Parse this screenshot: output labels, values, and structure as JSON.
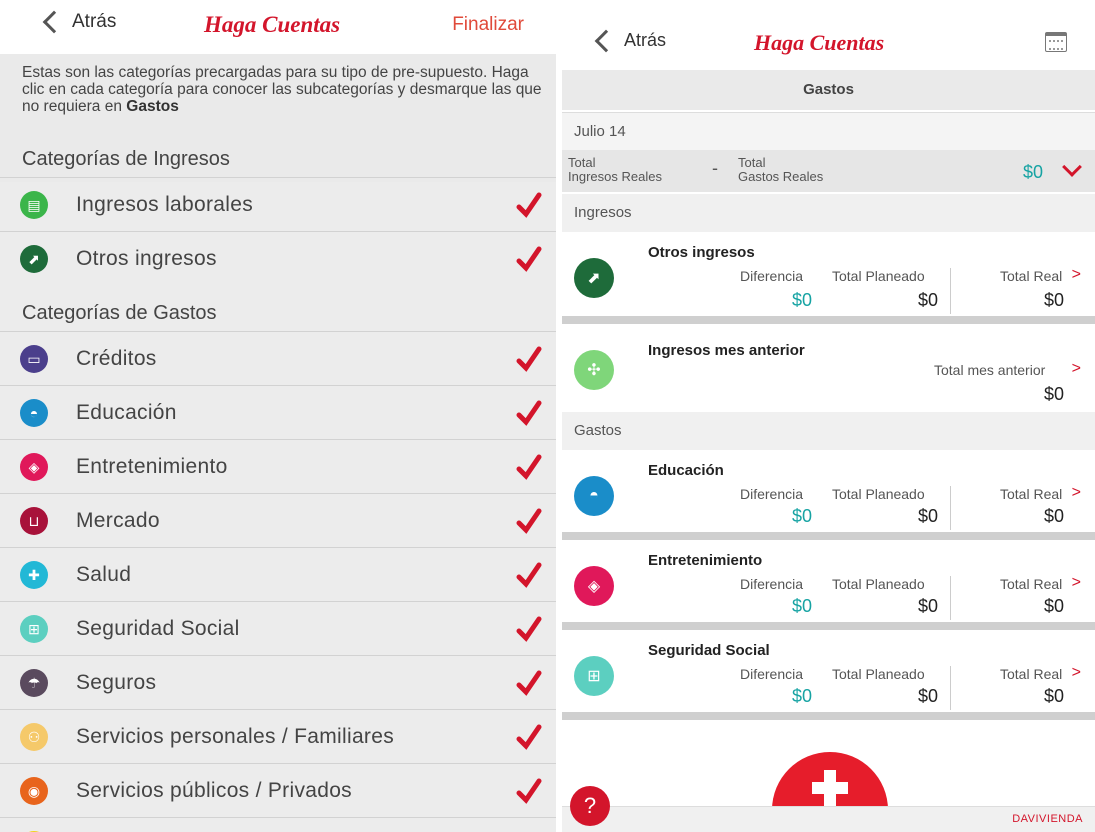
{
  "left": {
    "back_label": "Atrás",
    "brand": "Haga Cuentas",
    "finish_label": "Finalizar",
    "intro_text": "Estas son las categorías precargadas para su tipo de pre-supuesto. Haga clic en cada categoría para conocer las subcategorías y desmarque las que no requiera en",
    "intro_bold": "Gastos",
    "income_section": "Categorías de Ingresos",
    "income_items": [
      {
        "label": "Ingresos laborales",
        "icon": "payroll-icon",
        "color": "#3bb54a"
      },
      {
        "label": "Otros ingresos",
        "icon": "growth-chart-icon",
        "color": "#1e6b3a"
      }
    ],
    "expense_section": "Categorías de Gastos",
    "expense_items": [
      {
        "label": "Créditos",
        "icon": "wallet-icon",
        "color": "#4b3f8c"
      },
      {
        "label": "Educación",
        "icon": "graduation-cap-icon",
        "color": "#1a8dc9"
      },
      {
        "label": "Entretenimiento",
        "icon": "dice-icon",
        "color": "#e0185a"
      },
      {
        "label": "Mercado",
        "icon": "shopping-cart-icon",
        "color": "#a8123a"
      },
      {
        "label": "Salud",
        "icon": "medical-cross-icon",
        "color": "#22b8d6"
      },
      {
        "label": "Seguridad Social",
        "icon": "first-aid-kit-icon",
        "color": "#5ccfc0"
      },
      {
        "label": "Seguros",
        "icon": "umbrella-icon",
        "color": "#5a4a5e"
      },
      {
        "label": "Servicios personales / Familiares",
        "icon": "family-icon",
        "color": "#f5c96a"
      },
      {
        "label": "Servicios públicos / Privados",
        "icon": "utility-icon",
        "color": "#e8641c"
      }
    ],
    "check_color": "#d3152b"
  },
  "right": {
    "back_label": "Atrás",
    "brand": "Haga Cuentas",
    "tab_label": "Gastos",
    "date": "Julio 14",
    "totals": {
      "income_line1": "Total",
      "income_line2": "Ingresos Reales",
      "minus": "-",
      "expense_line1": "Total",
      "expense_line2": "Gastos Reales",
      "value": "$0"
    },
    "income_section": "Ingresos",
    "expense_section": "Gastos",
    "cards": [
      {
        "title": "Otros ingresos",
        "icon": "growth-chart-icon",
        "color": "#1e6b3a",
        "h_diff": "Diferencia",
        "h_plan": "Total Planeado",
        "h_real": "Total Real",
        "diff": "$0",
        "plan": "$0",
        "real": "$0"
      },
      {
        "title": "Ingresos mes anterior",
        "icon": "puzzle-icon",
        "color": "#7fd67a",
        "h_prev": "Total mes anterior",
        "prev": "$0"
      },
      {
        "title": "Educación",
        "icon": "graduation-cap-icon",
        "color": "#1a8dc9",
        "h_diff": "Diferencia",
        "h_plan": "Total Planeado",
        "h_real": "Total Real",
        "diff": "$0",
        "plan": "$0",
        "real": "$0"
      },
      {
        "title": "Entretenimiento",
        "icon": "dice-icon",
        "color": "#e0185a",
        "h_diff": "Diferencia",
        "h_plan": "Total Planeado",
        "h_real": "Total Real",
        "diff": "$0",
        "plan": "$0",
        "real": "$0"
      },
      {
        "title": "Seguridad Social",
        "icon": "first-aid-kit-icon",
        "color": "#5ccfc0",
        "h_diff": "Diferencia",
        "h_plan": "Total Planeado",
        "h_real": "Total Real",
        "diff": "$0",
        "plan": "$0",
        "real": "$0"
      }
    ],
    "help_label": "?",
    "footer_brand": "DAVIVIENDA",
    "accent_color": "#d3152b",
    "value_color": "#16a3a3"
  }
}
